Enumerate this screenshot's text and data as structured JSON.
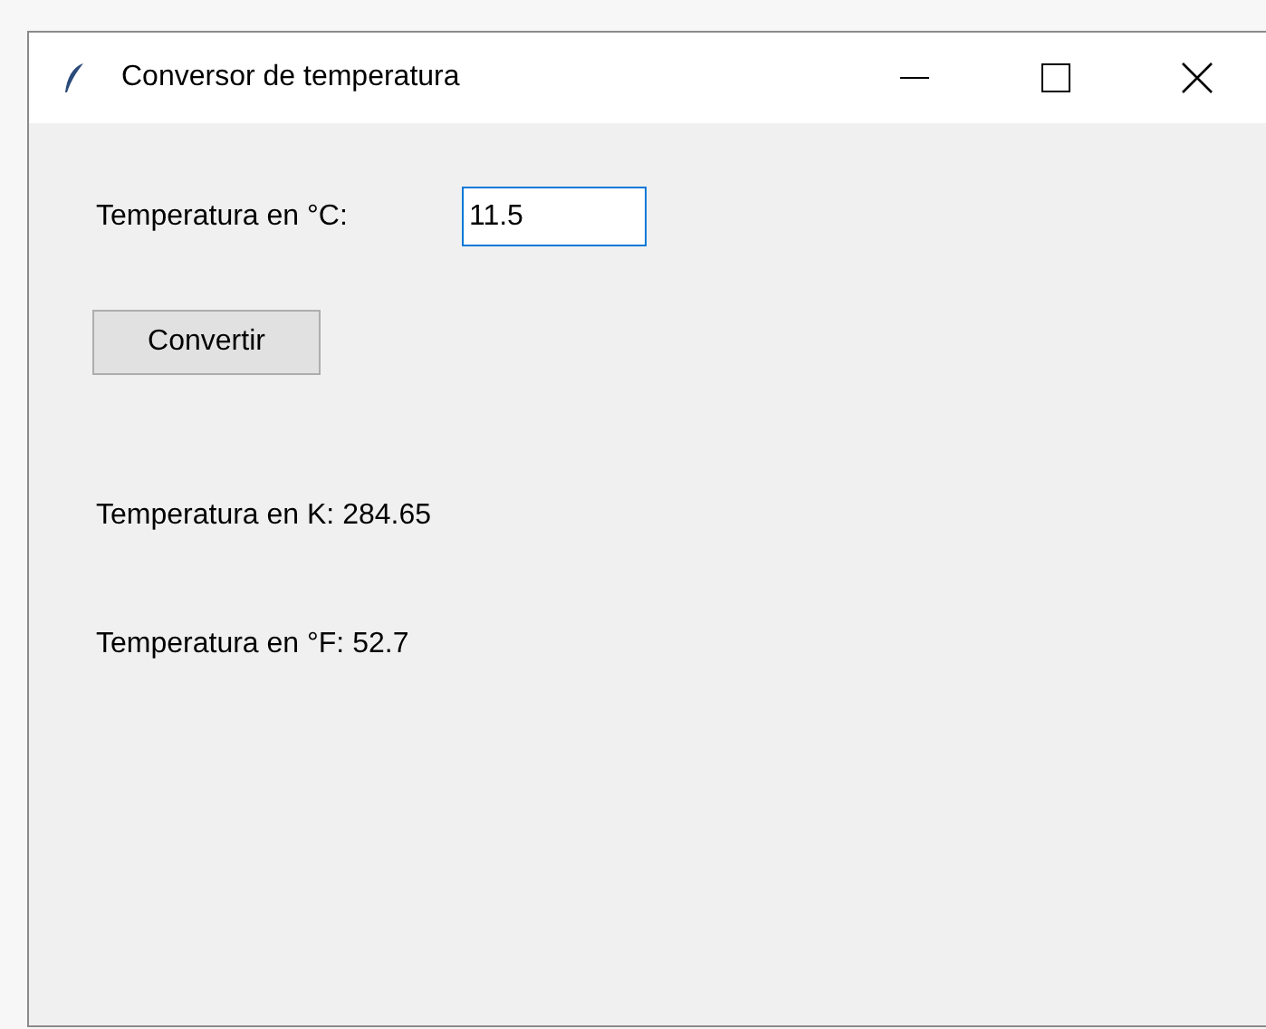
{
  "window": {
    "title": "Conversor de temperatura"
  },
  "input": {
    "label": "Temperatura en °C:",
    "value": "11.5",
    "focused": true
  },
  "button": {
    "label": "Convertir"
  },
  "results": [
    "Temperatura en K: 284.65",
    "Temperatura en °F: 52.7"
  ]
}
